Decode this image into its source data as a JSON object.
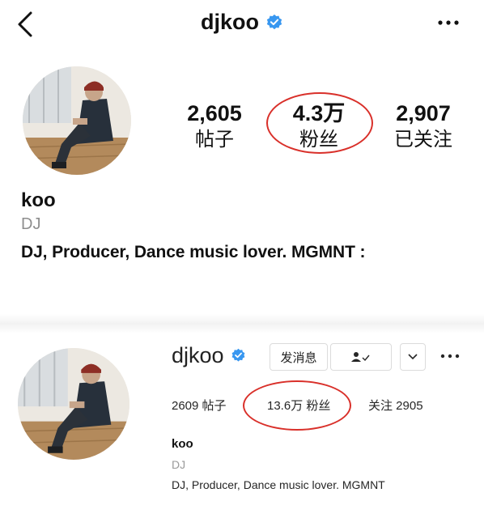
{
  "top": {
    "title": "djkoo",
    "stats": [
      {
        "value": "2,605",
        "label": "帖子"
      },
      {
        "value": "4.3万",
        "label": "粉丝"
      },
      {
        "value": "2,907",
        "label": "已关注"
      }
    ],
    "name": "koo",
    "category": "DJ",
    "bio": "DJ, Producer, Dance music lover. MGMNT :"
  },
  "bottom": {
    "username": "djkoo",
    "message_button": "发消息",
    "posts": "2609 帖子",
    "followers": "13.6万 粉丝",
    "following": "关注 2905",
    "name": "koo",
    "category": "DJ",
    "bio": "DJ, Producer, Dance music lover. MGMNT"
  },
  "colors": {
    "verified": "#3897f0",
    "highlight_ring": "#d9302a",
    "muted_text": "#8e8e8e"
  },
  "icons": [
    "back-arrow-icon",
    "verified-badge-icon",
    "more-icon",
    "user-check-icon",
    "chevron-down-icon"
  ]
}
